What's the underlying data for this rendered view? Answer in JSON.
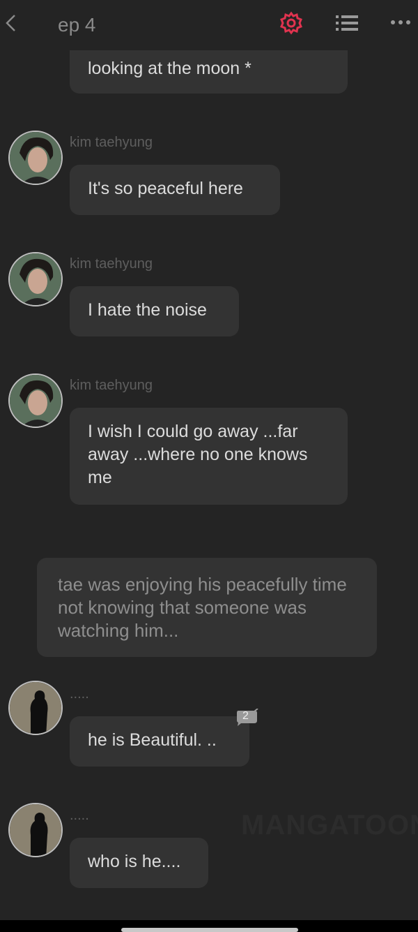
{
  "header": {
    "back_icon": "chevron-left-icon",
    "title": "ep 4",
    "settings_icon": "gear-icon",
    "list_icon": "list-icon",
    "more_icon": "more-horizontal-icon",
    "accent_color": "#e0334f"
  },
  "messages": [
    {
      "text": "looking at the moon *"
    },
    {
      "sender": "kim taehyung",
      "text": "It's so peaceful here"
    },
    {
      "sender": "kim taehyung",
      "text": "I hate the noise"
    },
    {
      "sender": "kim taehyung",
      "text": "I wish I could go away ...far away ...where no one knows me"
    },
    {
      "sender": ".....",
      "text": "he is Beautiful. ..",
      "comment_count": "2"
    },
    {
      "sender": ".....",
      "text": "who is he...."
    }
  ],
  "narration": {
    "text": "tae was enjoying his peacefully time not knowing that someone was watching him..."
  },
  "watermark": "MANGATOON"
}
